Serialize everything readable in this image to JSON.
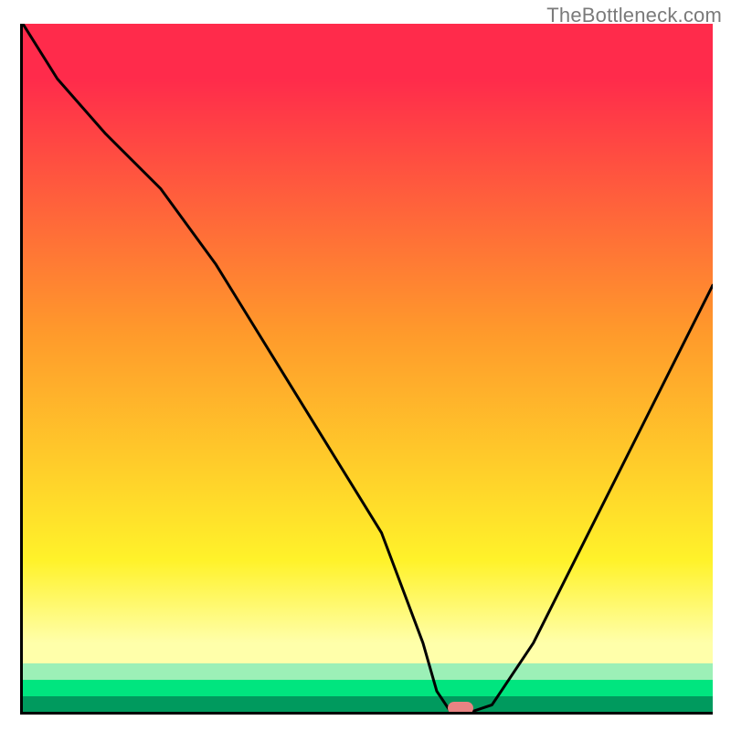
{
  "watermark": {
    "text": "TheBottleneck.com"
  },
  "colors": {
    "red": "#ff2b4b",
    "orange": "#ff9a2b",
    "yellow": "#fff22a",
    "paleYellow": "#ffffaa",
    "green": "#00e57f",
    "darkGreen": "#009a5e",
    "marker": "#e98383",
    "axis": "#000000"
  },
  "chart_data": {
    "type": "line",
    "title": "",
    "xlabel": "",
    "ylabel": "",
    "xlim": [
      0,
      100
    ],
    "ylim": [
      0,
      100
    ],
    "x": [
      0,
      5,
      12,
      20,
      28,
      36,
      44,
      52,
      58,
      60,
      62,
      65,
      68,
      74,
      82,
      90,
      100
    ],
    "y": [
      100,
      92,
      84,
      76,
      65,
      52,
      39,
      26,
      10,
      3,
      0,
      0,
      1,
      10,
      26,
      42,
      62
    ],
    "marker": {
      "x": 63.5,
      "y": 0.5
    }
  }
}
